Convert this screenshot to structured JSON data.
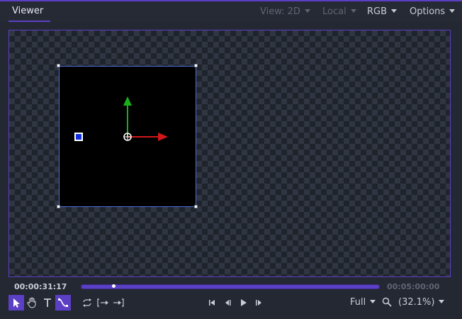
{
  "panel": {
    "tab_label": "Viewer"
  },
  "menus": {
    "view": "View: 2D",
    "space": "Local",
    "channel": "RGB",
    "options": "Options"
  },
  "timeline": {
    "current_time": "00:00:31:17",
    "end_time": "00:05:00:00",
    "playhead_fraction": 0.11
  },
  "toolbar": {
    "tools": [
      "select-tool",
      "hand-tool",
      "text-tool",
      "path-tool"
    ],
    "active_tools": [
      "select-tool",
      "path-tool"
    ],
    "resolution": "Full",
    "zoom": "(32.1%)"
  },
  "colors": {
    "accent": "#5b3fc4",
    "frame_border": "#4d6fe0",
    "x_axis": "#d01818",
    "y_axis": "#18b018",
    "marker": "#1030e0"
  }
}
